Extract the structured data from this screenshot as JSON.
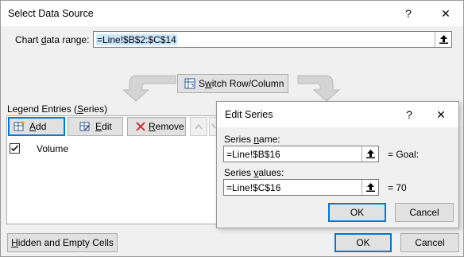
{
  "dialog": {
    "title": "Select Data Source",
    "help": "?",
    "close": "✕"
  },
  "range": {
    "label_pre": "Chart ",
    "label_u": "d",
    "label_post": "ata range:",
    "value": "=Line!$B$2:$C$14"
  },
  "switch": {
    "label_u": "w",
    "label_pre": "S",
    "label_post": "itch Row/Column"
  },
  "legend": {
    "label_pre": "Legend Entries (",
    "label_u": "S",
    "label_post": "eries)",
    "add_u": "A",
    "add_post": "dd",
    "edit_u": "E",
    "edit_post": "dit",
    "remove_u": "R",
    "remove_post": "emove",
    "items": [
      {
        "label": "Volume",
        "checked": true
      }
    ]
  },
  "footer": {
    "hidden_u": "H",
    "hidden_post": "idden and Empty Cells",
    "ok": "OK",
    "cancel": "Cancel"
  },
  "edit_series": {
    "title": "Edit Series",
    "help": "?",
    "close": "✕",
    "name_label_pre": "Series ",
    "name_label_u": "n",
    "name_label_post": "ame:",
    "name_value": "=Line!$B$16",
    "name_result": "= Goal:",
    "values_label_pre": "Series ",
    "values_label_u": "v",
    "values_label_post": "alues:",
    "values_value": "=Line!$C$16",
    "values_result": "= 70",
    "ok": "OK",
    "cancel": "Cancel"
  }
}
